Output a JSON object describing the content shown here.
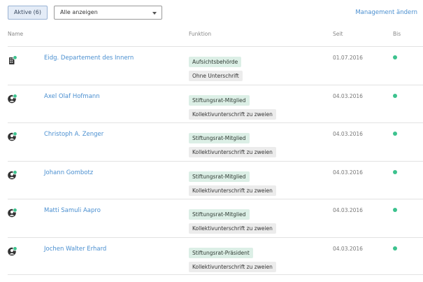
{
  "toolbar": {
    "active_button": "Aktive (6)",
    "filter_value": "Alle anzeigen",
    "management_link": "Management ändern"
  },
  "columns": {
    "name": "Name",
    "function": "Funktion",
    "since": "Seit",
    "until": "Bis"
  },
  "status_color": "#3cc28e",
  "rows": [
    {
      "icon": "building-icon",
      "name": "Eidg. Departement des Innern",
      "role": "Aufsichtsbehörde",
      "signature": "Ohne Unterschrift",
      "since": "01.07.2016"
    },
    {
      "icon": "person-icon",
      "name": "Axel Olaf Hofmann",
      "role": "Stiftungsrat-Mitglied",
      "signature": "Kollektivunterschrift zu zweien",
      "since": "04.03.2016"
    },
    {
      "icon": "person-icon",
      "name": "Christoph A. Zenger",
      "role": "Stiftungsrat-Mitglied",
      "signature": "Kollektivunterschrift zu zweien",
      "since": "04.03.2016"
    },
    {
      "icon": "person-icon",
      "name": "Johann Gombotz",
      "role": "Stiftungsrat-Mitglied",
      "signature": "Kollektivunterschrift zu zweien",
      "since": "04.03.2016"
    },
    {
      "icon": "person-icon",
      "name": "Matti Samuli Aapro",
      "role": "Stiftungsrat-Mitglied",
      "signature": "Kollektivunterschrift zu zweien",
      "since": "04.03.2016"
    },
    {
      "icon": "person-icon",
      "name": "Jochen Walter Erhard",
      "role": "Stiftungsrat-Präsident",
      "signature": "Kollektivunterschrift zu zweien",
      "since": "04.03.2016"
    }
  ]
}
